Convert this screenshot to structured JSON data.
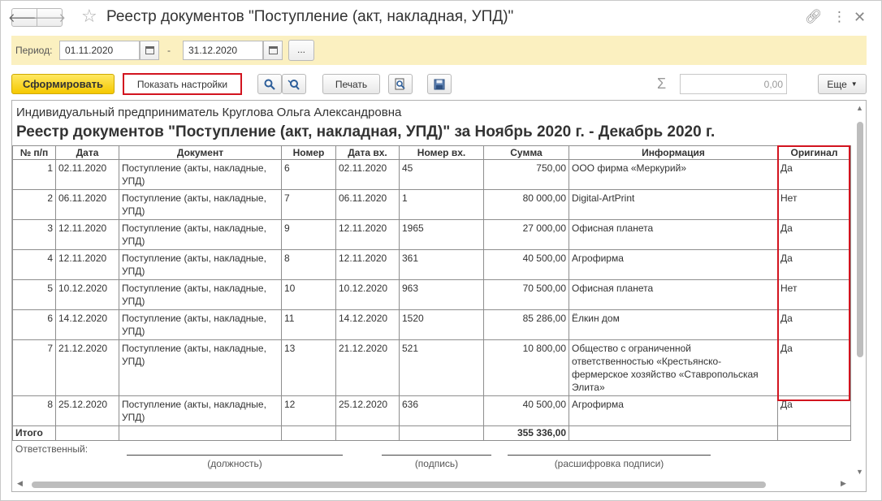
{
  "window": {
    "title": "Реестр документов \"Поступление (акт, накладная, УПД)\"",
    "nav_back": "🡐",
    "nav_forward": "🡒",
    "icons": [
      "star-icon",
      "link-icon",
      "more-vertical-icon",
      "close-icon"
    ]
  },
  "period": {
    "label": "Период:",
    "from": "01.11.2020",
    "dash": "-",
    "to": "31.12.2020",
    "more_label": "..."
  },
  "toolbar": {
    "generate_label": "Сформировать",
    "show_settings_label": "Показать настройки",
    "print_label": "Печать",
    "sum_value": "0,00",
    "more_label": "Еще"
  },
  "report": {
    "org": "Индивидуальный предприниматель Круглова Ольга Александровна",
    "title": "Реестр документов \"Поступление (акт, накладная, УПД)\" за Ноябрь 2020 г. - Декабрь 2020 г.",
    "columns": [
      "№ п/п",
      "Дата",
      "Документ",
      "Номер",
      "Дата вх.",
      "Номер вх.",
      "Сумма",
      "Информация",
      "Оригинал"
    ],
    "rows": [
      {
        "n": "1",
        "date": "02.11.2020",
        "doc": "Поступление (акты, накладные, УПД)",
        "num": "6",
        "date_in": "02.11.2020",
        "num_in": "45",
        "sum": "750,00",
        "info": "ООО фирма «Меркурий»",
        "original": "Да"
      },
      {
        "n": "2",
        "date": "06.11.2020",
        "doc": "Поступление (акты, накладные, УПД)",
        "num": "7",
        "date_in": "06.11.2020",
        "num_in": "1",
        "sum": "80 000,00",
        "info": "Digital-ArtPrint",
        "original": "Нет"
      },
      {
        "n": "3",
        "date": "12.11.2020",
        "doc": "Поступление (акты, накладные, УПД)",
        "num": "9",
        "date_in": "12.11.2020",
        "num_in": "1965",
        "sum": "27 000,00",
        "info": "Офисная планета",
        "original": "Да"
      },
      {
        "n": "4",
        "date": "12.11.2020",
        "doc": "Поступление (акты, накладные, УПД)",
        "num": "8",
        "date_in": "12.11.2020",
        "num_in": "361",
        "sum": "40 500,00",
        "info": "Агрофирма",
        "original": "Да"
      },
      {
        "n": "5",
        "date": "10.12.2020",
        "doc": "Поступление (акты, накладные, УПД)",
        "num": "10",
        "date_in": "10.12.2020",
        "num_in": "963",
        "sum": "70 500,00",
        "info": "Офисная планета",
        "original": "Нет"
      },
      {
        "n": "6",
        "date": "14.12.2020",
        "doc": "Поступление (акты, накладные, УПД)",
        "num": "11",
        "date_in": "14.12.2020",
        "num_in": "1520",
        "sum": "85 286,00",
        "info": "Ёлкин дом",
        "original": "Да"
      },
      {
        "n": "7",
        "date": "21.12.2020",
        "doc": "Поступление (акты, накладные, УПД)",
        "num": "13",
        "date_in": "21.12.2020",
        "num_in": "521",
        "sum": "10 800,00",
        "info": "Общество с ограниченной ответственностью «Крестьянско-фермерское хозяйство «Ставропольская Элита»",
        "original": "Да"
      },
      {
        "n": "8",
        "date": "25.12.2020",
        "doc": "Поступление (акты, накладные, УПД)",
        "num": "12",
        "date_in": "25.12.2020",
        "num_in": "636",
        "sum": "40 500,00",
        "info": "Агрофирма",
        "original": "Да"
      }
    ],
    "total_label": "Итого",
    "total_sum": "355 336,00",
    "responsible_label": "Ответственный:",
    "sign_captions": [
      "(должность)",
      "(подпись)",
      "(расшифровка подписи)"
    ]
  },
  "colors": {
    "accent": "#f5c800",
    "period_bg": "#fbf0c0",
    "highlight": "#d2141f"
  }
}
